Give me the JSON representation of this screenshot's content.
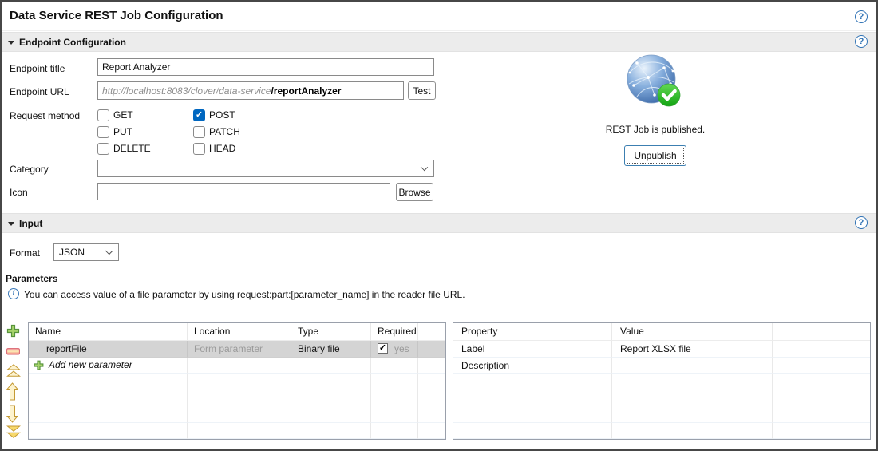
{
  "icons": {
    "help_glyph": "?",
    "info_glyph": "i"
  },
  "window": {
    "title": "Data Service REST Job Configuration"
  },
  "endpoint_section": {
    "title": "Endpoint Configuration",
    "fields": {
      "endpoint_title": {
        "label": "Endpoint title",
        "value": "Report Analyzer"
      },
      "endpoint_url": {
        "label": "Endpoint URL",
        "url_prefix": "http://localhost:8083/clover/data-service",
        "url_editable": "/reportAnalyzer",
        "test_button": "Test"
      },
      "request_method": {
        "label": "Request method",
        "options": [
          {
            "label": "GET",
            "checked": false
          },
          {
            "label": "POST",
            "checked": true
          },
          {
            "label": "PUT",
            "checked": false
          },
          {
            "label": "PATCH",
            "checked": false
          },
          {
            "label": "DELETE",
            "checked": false
          },
          {
            "label": "HEAD",
            "checked": false
          }
        ]
      },
      "category": {
        "label": "Category",
        "value": ""
      },
      "icon": {
        "label": "Icon",
        "value": "",
        "browse_button": "Browse"
      }
    },
    "publish": {
      "status_text": "REST Job is published.",
      "button_label": "Unpublish"
    }
  },
  "input_section": {
    "title": "Input",
    "format": {
      "label": "Format",
      "value": "JSON"
    },
    "parameters": {
      "heading": "Parameters",
      "info_text": "You can access value of a file parameter by using request:part:[parameter_name] in the reader file URL.",
      "add_row_label": "Add new parameter",
      "param_table": {
        "headers": [
          "Name",
          "Location",
          "Type",
          "Required"
        ],
        "rows": [
          {
            "name": "reportFile",
            "location": "Form parameter",
            "type": "Binary file",
            "required": true,
            "required_label": "yes"
          }
        ]
      },
      "property_table": {
        "headers": [
          "Property",
          "Value"
        ],
        "rows": [
          {
            "property": "Label",
            "value": "Report XLSX file"
          },
          {
            "property": "Description",
            "value": ""
          }
        ]
      }
    }
  },
  "colors": {
    "accent_checkbox": "#0067c0",
    "help_icon_blue": "#3173b5",
    "published_green": "#2eb52e",
    "selected_row_gray": "#d4d4d4"
  }
}
